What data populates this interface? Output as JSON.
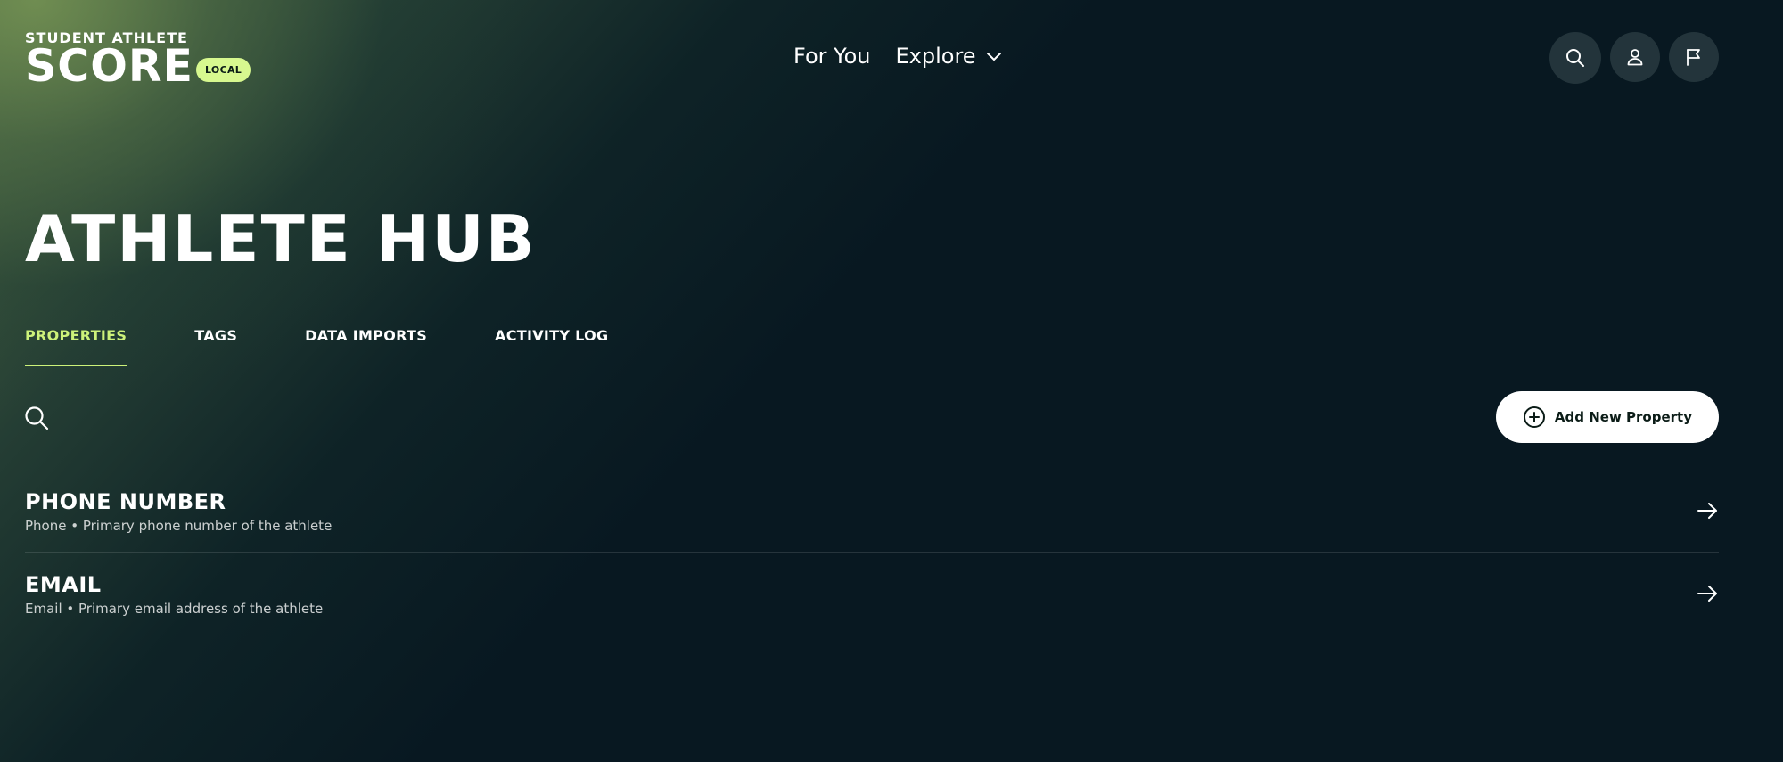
{
  "brand": {
    "line1": "STUDENT ATHLETE",
    "line2": "SCORE",
    "badge": "LOCAL",
    "badge_color": "#d7f88f"
  },
  "nav": {
    "for_you": "For You",
    "explore": "Explore",
    "explore_icon": "chevron-down-icon"
  },
  "header_actions": {
    "search_icon": "search-icon",
    "profile_icon": "user-icon",
    "flag_icon": "flag-icon"
  },
  "page": {
    "title": "ATHLETE HUB"
  },
  "tabs": [
    {
      "label": "PROPERTIES",
      "active": true
    },
    {
      "label": "TAGS",
      "active": false
    },
    {
      "label": "DATA IMPORTS",
      "active": false
    },
    {
      "label": "ACTIVITY LOG",
      "active": false
    }
  ],
  "toolbar": {
    "search_icon": "search-icon",
    "add_label": "Add New Property",
    "add_icon": "plus-circle-icon"
  },
  "properties": [
    {
      "name": "PHONE NUMBER",
      "description": "Phone • Primary phone number of the athlete"
    },
    {
      "name": "EMAIL",
      "description": "Email • Primary email address of the athlete"
    }
  ],
  "colors": {
    "accent": "#cdf27a",
    "background": "#081821"
  }
}
